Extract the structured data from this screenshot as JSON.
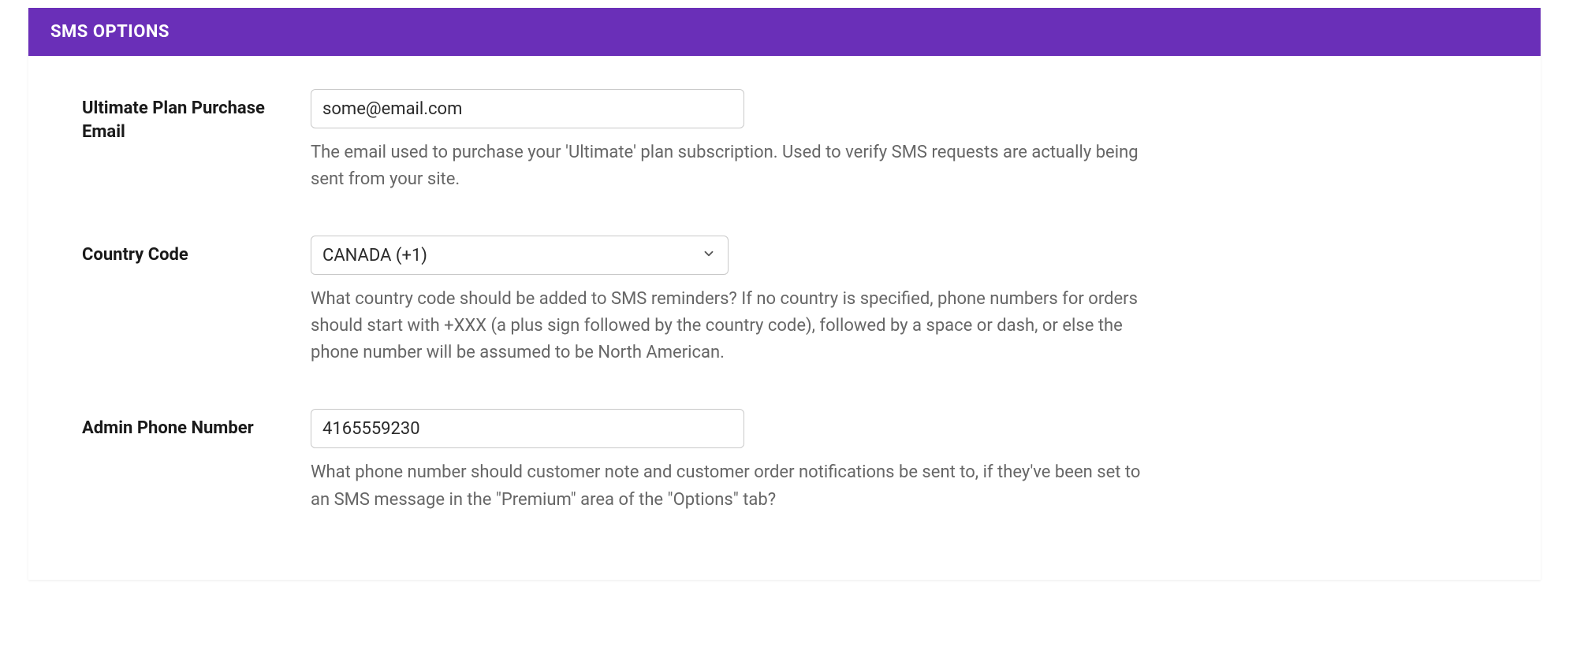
{
  "panel": {
    "title": "SMS OPTIONS"
  },
  "fields": {
    "email": {
      "label": "Ultimate Plan Purchase Email",
      "value": "some@email.com",
      "help": "The email used to purchase your 'Ultimate' plan subscription. Used to verify SMS requests are actually being sent from your site."
    },
    "country": {
      "label": "Country Code",
      "selected": "CANADA (+1)",
      "help": "What country code should be added to SMS reminders? If no country is specified, phone numbers for orders should start with +XXX (a plus sign followed by the country code), followed by a space or dash, or else the phone number will be assumed to be North American."
    },
    "phone": {
      "label": "Admin Phone Number",
      "value": "4165559230",
      "help": "What phone number should customer note and customer order notifications be sent to, if they've been set to an SMS message in the \"Premium\" area of the \"Options\" tab?"
    }
  }
}
